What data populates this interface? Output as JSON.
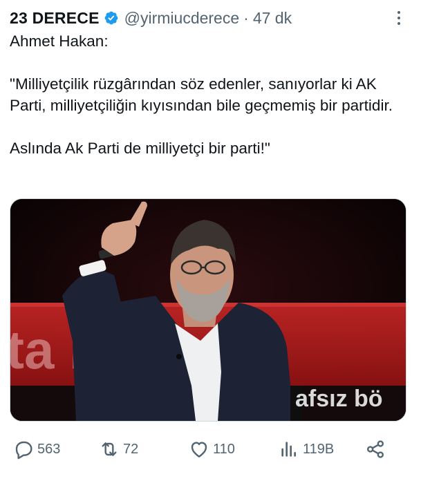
{
  "tweet": {
    "display_name": "23 DERECE",
    "handle": "@yirmiucderece",
    "separator": "·",
    "time": "47 dk",
    "text": "Ahmet Hakan:\n\n\"Milliyetçilik rüzgârından söz edenler, sanıyorlar ki AK Parti, milliyetçiliğin kıyısından bile geçmemiş bir partidir.\n\nAslında Ak Parti de milliyetçi bir parti!\"",
    "media": {
      "overlay_text": "afsız bö",
      "background_letters": "ta bö"
    }
  },
  "actions": {
    "replies": "563",
    "retweets": "72",
    "likes": "110",
    "views": "119B"
  },
  "colors": {
    "text": "#0f1419",
    "secondary": "#536471",
    "verified": "#1d9bf0",
    "studio_red": "#b51e1e"
  }
}
